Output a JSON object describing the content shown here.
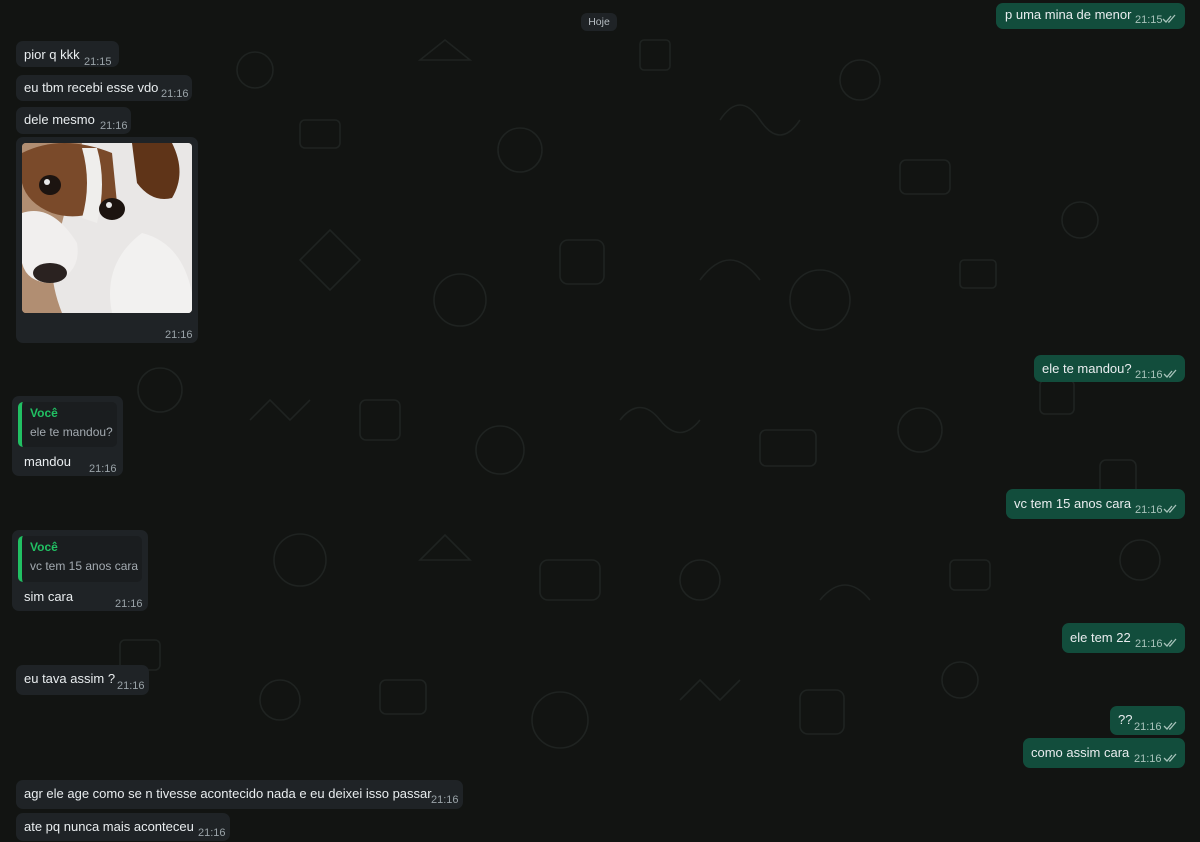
{
  "chat": {
    "day_separator": "Hoje",
    "messages": [
      {
        "id": "m1",
        "direction": "out",
        "text": "p uma mina de menor",
        "time": "21:15",
        "status": "read"
      },
      {
        "id": "m2",
        "direction": "in",
        "text": "pior q kkk",
        "time": "21:15"
      },
      {
        "id": "m3",
        "direction": "in",
        "text": "eu tbm recebi esse vdo",
        "time": "21:16"
      },
      {
        "id": "m4",
        "direction": "in",
        "text": "dele mesmo",
        "time": "21:16"
      },
      {
        "id": "m5",
        "direction": "in",
        "type": "image",
        "image_subject": "white and brown puppy",
        "time": "21:16"
      },
      {
        "id": "m6",
        "direction": "out",
        "text": "ele te mandou?",
        "time": "21:16",
        "status": "read"
      },
      {
        "id": "m7",
        "direction": "in",
        "quote_author": "Você",
        "quote_text": "ele te mandou?",
        "text": "mandou",
        "time": "21:16"
      },
      {
        "id": "m8",
        "direction": "out",
        "text": "vc tem 15 anos cara",
        "time": "21:16",
        "status": "read"
      },
      {
        "id": "m9",
        "direction": "in",
        "quote_author": "Você",
        "quote_text": "vc tem 15 anos cara",
        "text": "sim cara",
        "time": "21:16"
      },
      {
        "id": "m10",
        "direction": "out",
        "text": "ele tem 22",
        "time": "21:16",
        "status": "read"
      },
      {
        "id": "m11",
        "direction": "in",
        "text": "eu tava assim ?",
        "time": "21:16"
      },
      {
        "id": "m12",
        "direction": "out",
        "text": "??",
        "time": "21:16",
        "status": "read"
      },
      {
        "id": "m13",
        "direction": "out",
        "text": "como assim cara",
        "time": "21:16",
        "status": "read"
      },
      {
        "id": "m14",
        "direction": "in",
        "text": "agr ele age como se n tivesse acontecido nada e eu deixei isso passar",
        "time": "21:16"
      },
      {
        "id": "m15",
        "direction": "in",
        "text": "ate pq nunca mais aconteceu",
        "time": "21:16"
      }
    ]
  },
  "colors": {
    "background": "#121412",
    "incoming_bubble": "#1f2326",
    "outgoing_bubble": "#124d3c",
    "read_ticks": "#a8c3bb",
    "quote_accent": "#21c063"
  },
  "icons": {
    "read_status": "double-check-icon"
  }
}
